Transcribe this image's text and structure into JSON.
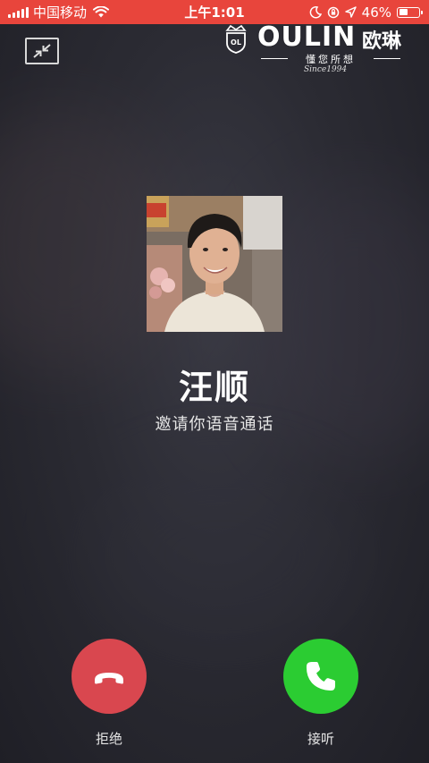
{
  "status_bar": {
    "carrier": "中国移动",
    "time": "上午1:01",
    "battery_percent": "46%",
    "battery_level": 0.46,
    "background_color": "#e8453c"
  },
  "watermark": {
    "brand": "OULIN",
    "brand_cn": "欧琳",
    "slogan": "懂您所想",
    "since": "Since1994"
  },
  "call": {
    "caller_name": "汪顺",
    "subtitle": "邀请你语音通话"
  },
  "actions": {
    "decline_label": "拒绝",
    "accept_label": "接听",
    "decline_color": "#d9474f",
    "accept_color": "#2bcc32"
  },
  "icons": {
    "minimize": "minimize-arrows-icon",
    "decline": "phone-hangup-icon",
    "accept": "phone-icon"
  }
}
